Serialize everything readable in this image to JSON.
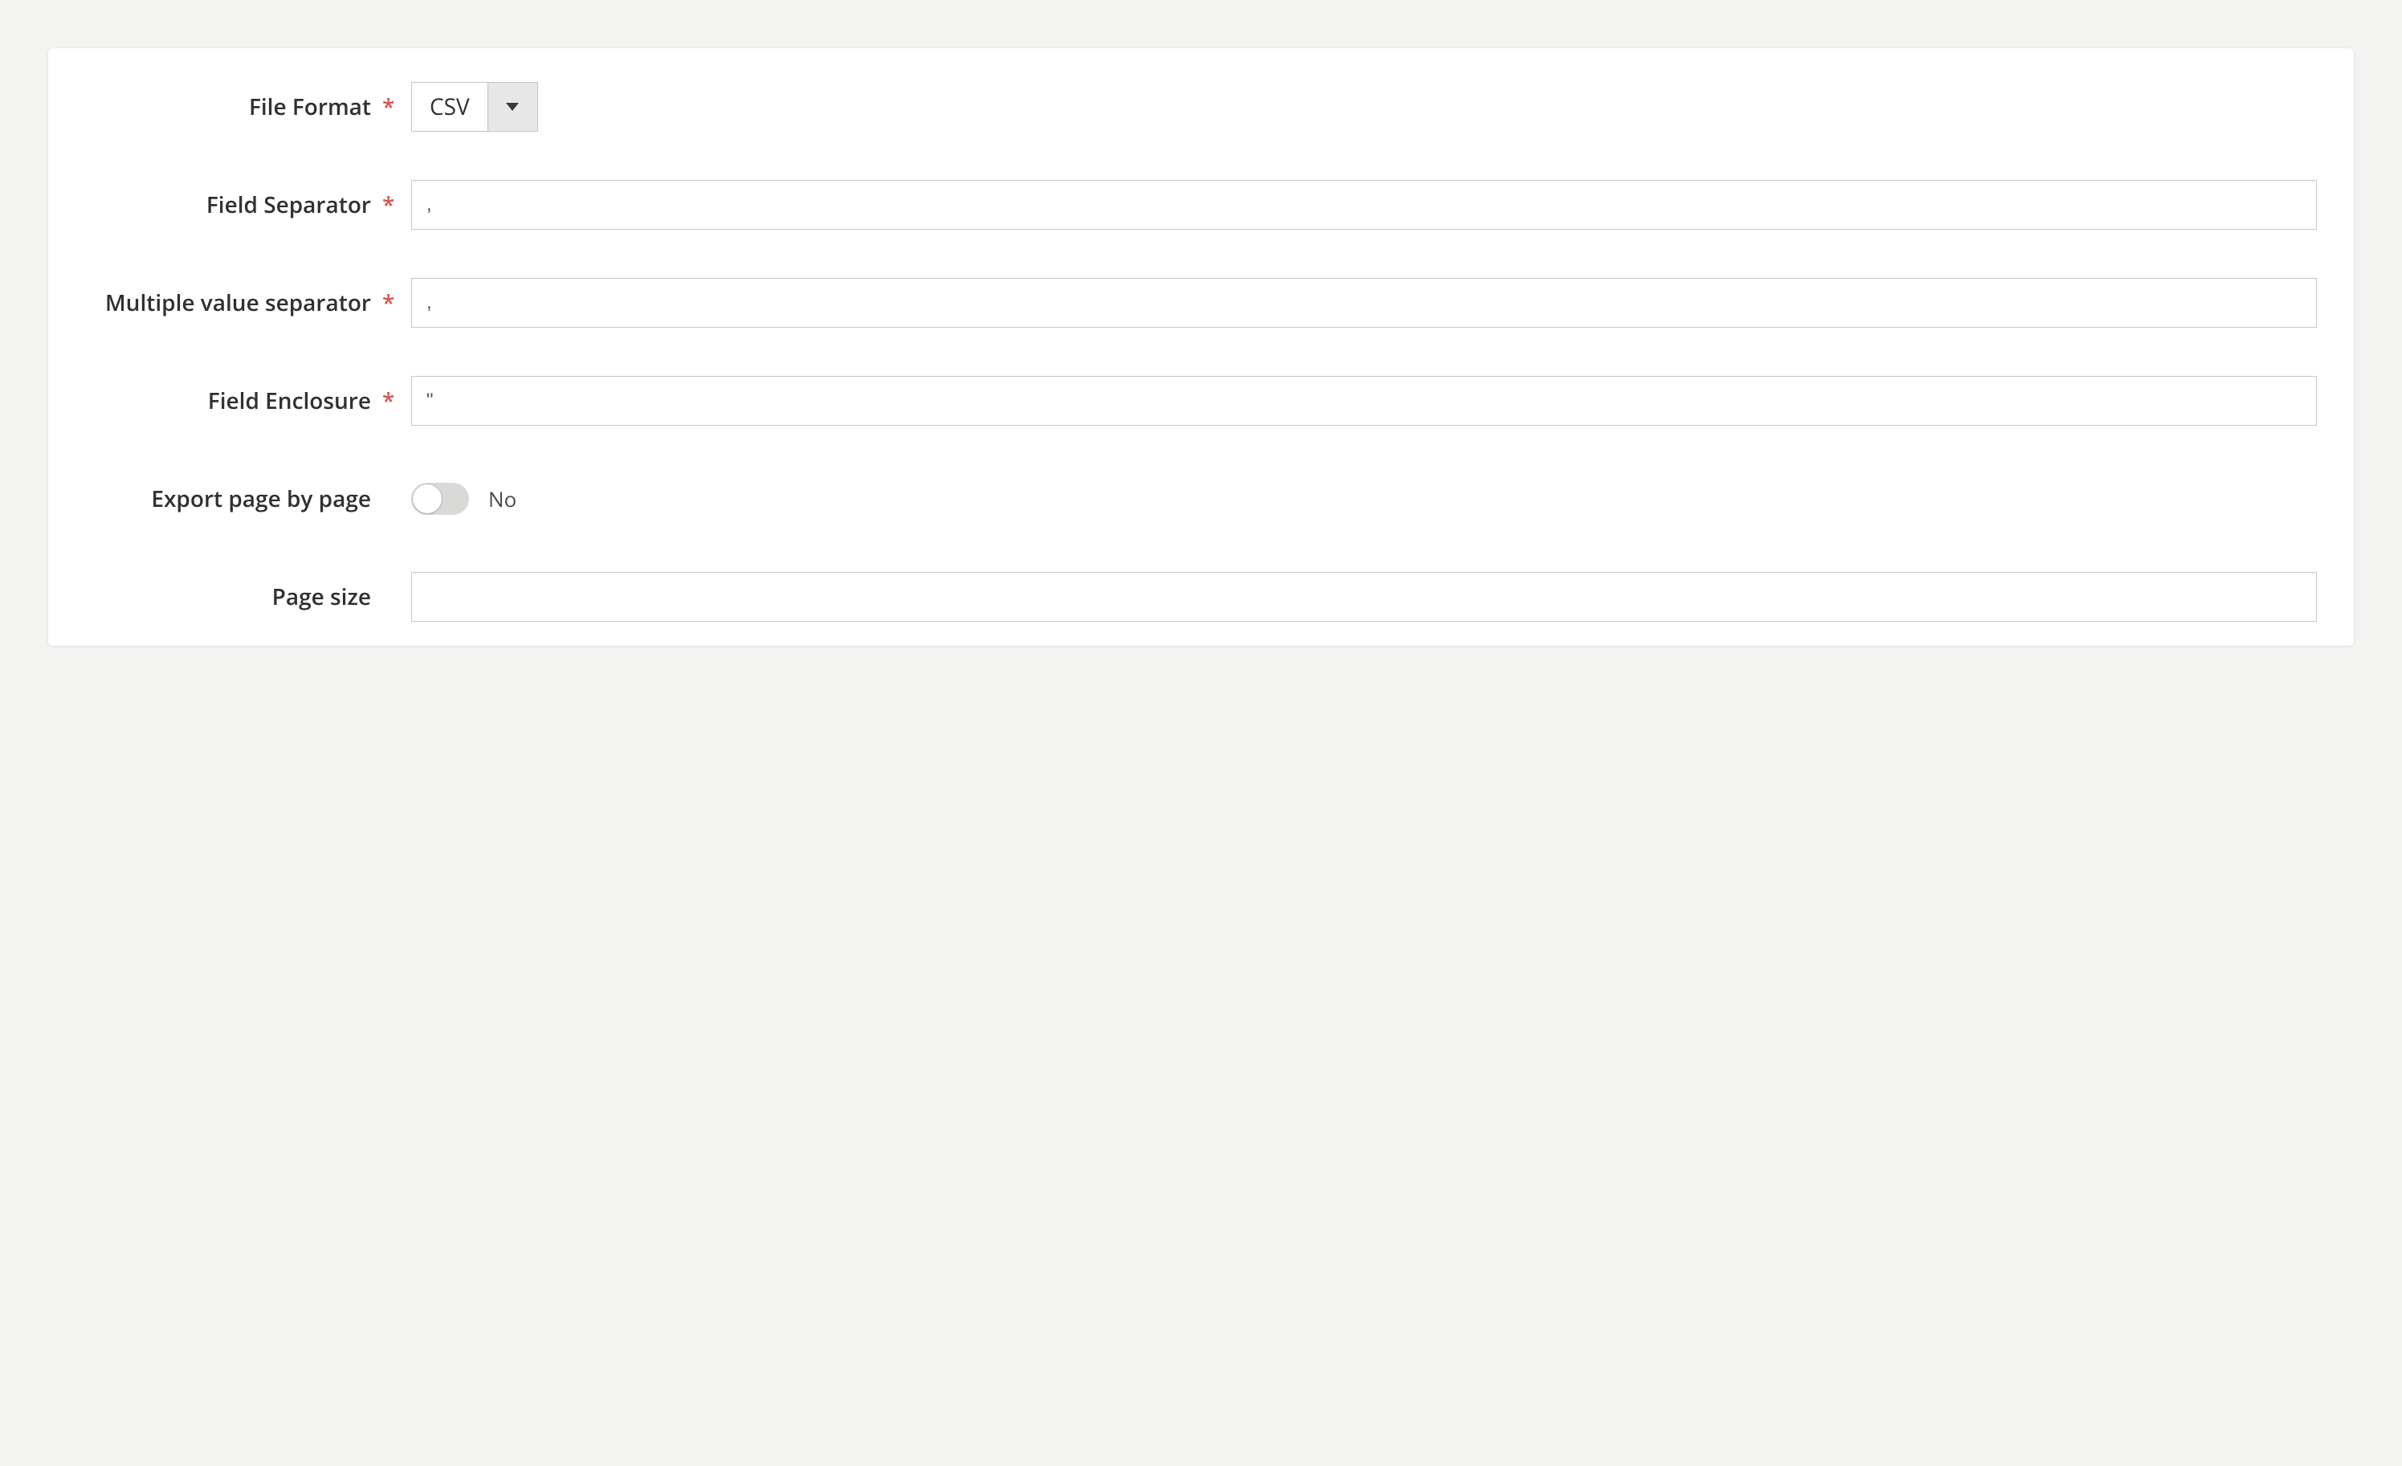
{
  "form": {
    "file_format": {
      "label": "File Format",
      "required_marker": "*",
      "value": "CSV"
    },
    "field_separator": {
      "label": "Field Separator",
      "required_marker": "*",
      "value": ","
    },
    "multiple_value_separator": {
      "label": "Multiple value separator",
      "required_marker": "*",
      "value": ","
    },
    "field_enclosure": {
      "label": "Field Enclosure",
      "required_marker": "*",
      "value": "\""
    },
    "export_page_by_page": {
      "label": "Export page by page",
      "state_text": "No"
    },
    "page_size": {
      "label": "Page size",
      "value": ""
    }
  }
}
